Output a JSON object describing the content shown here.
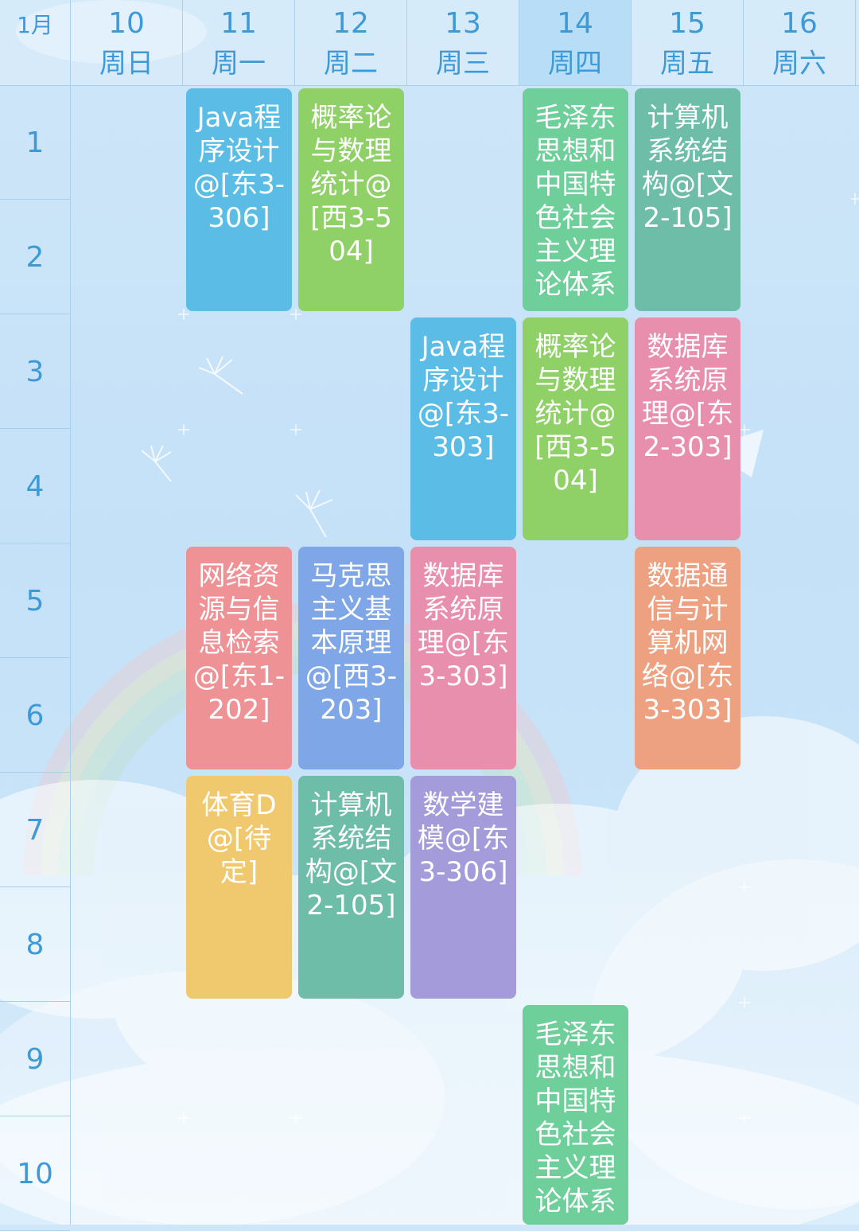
{
  "header": {
    "month": "1月",
    "days": [
      {
        "num": "10",
        "name": "周日"
      },
      {
        "num": "11",
        "name": "周一"
      },
      {
        "num": "12",
        "name": "周二"
      },
      {
        "num": "13",
        "name": "周三"
      },
      {
        "num": "14",
        "name": "周四"
      },
      {
        "num": "15",
        "name": "周五"
      },
      {
        "num": "16",
        "name": "周六"
      }
    ],
    "today_index": 4
  },
  "periods": [
    "1",
    "2",
    "3",
    "4",
    "5",
    "6",
    "7",
    "8",
    "9",
    "10"
  ],
  "courses": [
    {
      "day": 1,
      "start": 1,
      "span": 2,
      "text": "Java程序设计@[东3-306]",
      "color": "#5bbde6"
    },
    {
      "day": 2,
      "start": 1,
      "span": 2,
      "text": "概率论与数理统计@[西3-504]",
      "color": "#8fd067"
    },
    {
      "day": 4,
      "start": 1,
      "span": 2,
      "text": "毛泽东思想和中国特色社会主义理论体系",
      "color": "#6ecf9a"
    },
    {
      "day": 5,
      "start": 1,
      "span": 2,
      "text": "计算机系统结构@[文2-105]",
      "color": "#6dbda8"
    },
    {
      "day": 3,
      "start": 3,
      "span": 2,
      "text": "Java程序设计@[东3-303]",
      "color": "#5bbde6"
    },
    {
      "day": 4,
      "start": 3,
      "span": 2,
      "text": "概率论与数理统计@[西3-504]",
      "color": "#8fd067"
    },
    {
      "day": 5,
      "start": 3,
      "span": 2,
      "text": "数据库系统原理@[东2-303]",
      "color": "#e98fae"
    },
    {
      "day": 1,
      "start": 5,
      "span": 2,
      "text": "网络资源与信息检索@[东1-202]",
      "color": "#ee9296"
    },
    {
      "day": 2,
      "start": 5,
      "span": 2,
      "text": "马克思主义基本原理@[西3-203]",
      "color": "#7fa6e6"
    },
    {
      "day": 3,
      "start": 5,
      "span": 2,
      "text": "数据库系统原理@[东3-303]",
      "color": "#e98fae"
    },
    {
      "day": 5,
      "start": 5,
      "span": 2,
      "text": "数据通信与计算机网络@[东3-303]",
      "color": "#eea181"
    },
    {
      "day": 1,
      "start": 7,
      "span": 2,
      "text": "体育D@[待定]",
      "color": "#f0c86e"
    },
    {
      "day": 2,
      "start": 7,
      "span": 2,
      "text": "计算机系统结构@[文2-105]",
      "color": "#6dbda8"
    },
    {
      "day": 3,
      "start": 7,
      "span": 2,
      "text": "数学建模@[东3-306]",
      "color": "#a49bdb"
    },
    {
      "day": 4,
      "start": 9,
      "span": 2,
      "text": "毛泽东思想和中国特色社会主义理论体系",
      "color": "#6ecf9a"
    }
  ]
}
